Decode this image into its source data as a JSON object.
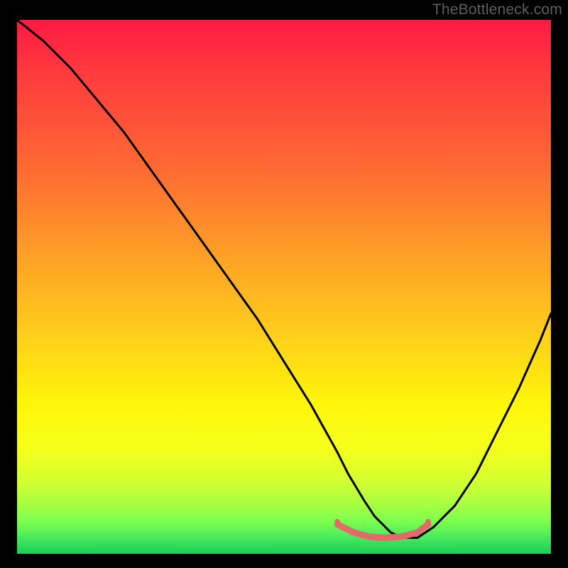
{
  "watermark": "TheBottleneck.com",
  "chart_data": {
    "type": "line",
    "title": "",
    "xlabel": "",
    "ylabel": "",
    "xlim": [
      0,
      100
    ],
    "ylim": [
      0,
      100
    ],
    "background_gradient_stops": [
      {
        "pos": 0,
        "color": "#ff1a44"
      },
      {
        "pos": 10,
        "color": "#ff3b3e"
      },
      {
        "pos": 28,
        "color": "#ff6a33"
      },
      {
        "pos": 45,
        "color": "#ffa326"
      },
      {
        "pos": 60,
        "color": "#ffd21a"
      },
      {
        "pos": 72,
        "color": "#fff60a"
      },
      {
        "pos": 80,
        "color": "#f6ff1a"
      },
      {
        "pos": 86,
        "color": "#d6ff30"
      },
      {
        "pos": 90,
        "color": "#b0ff40"
      },
      {
        "pos": 94,
        "color": "#7cff4f"
      },
      {
        "pos": 97,
        "color": "#46e85e"
      },
      {
        "pos": 100,
        "color": "#19cf56"
      }
    ],
    "series": [
      {
        "name": "bottleneck-curve",
        "color": "#000000",
        "x": [
          0,
          5,
          10,
          15,
          20,
          25,
          30,
          35,
          40,
          45,
          50,
          55,
          60,
          62,
          65,
          67,
          70,
          72,
          75,
          78,
          82,
          86,
          90,
          94,
          98,
          100
        ],
        "y": [
          100,
          96,
          91,
          85,
          79,
          72,
          65,
          58,
          51,
          44,
          36,
          28,
          19,
          15,
          10,
          7,
          4,
          3,
          3,
          5,
          9,
          15,
          23,
          31,
          40,
          45
        ]
      }
    ],
    "markers": [
      {
        "name": "valley-start-marker",
        "x": 60,
        "y": 6,
        "color": "#e46a6a",
        "size": 8
      },
      {
        "name": "valley-end-marker",
        "x": 77,
        "y": 6,
        "color": "#e46a6a",
        "size": 8
      }
    ],
    "highlights": [
      {
        "name": "valley-floor-band",
        "color": "#e46a6a",
        "thickness": 9,
        "x": [
          60,
          63,
          66,
          69,
          72,
          75,
          77
        ],
        "y": [
          5.5,
          4.0,
          3.2,
          3.0,
          3.2,
          4.0,
          5.5
        ]
      }
    ]
  }
}
